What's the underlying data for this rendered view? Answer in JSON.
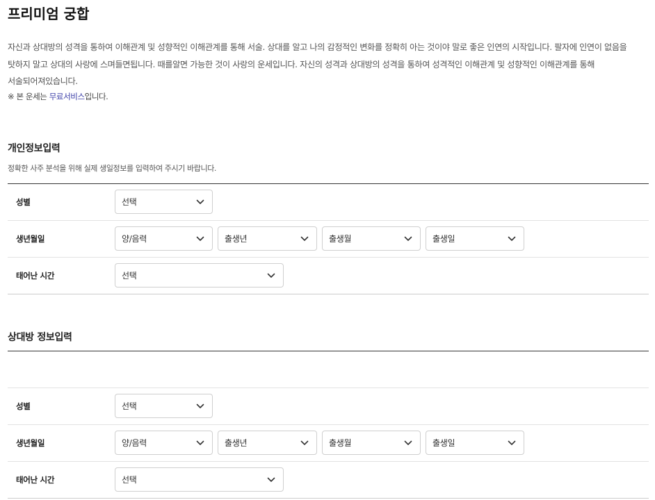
{
  "page": {
    "title": "프리미엄 궁합",
    "description": "자신과 상대방의 성격을 통하여 이해관계 및 성향적인 이해관계를 통해 서술. 상대를 알고 나의 감정적인 변화를 정확히 아는 것이야 말로 좋은 인연의 시작입니다. 팔자에 인연이 없음을 탓하지 말고 상대의 사랑에 스며들면됩니다. 때를알면 가능한 것이 사랑의 운세입니다. 자신의 성격과 상대방의 성격을 통하여 성격적인 이해관계 및 성향적인 이해관계를 통해 서술되어져있습니다.",
    "notice_prefix": "※ 본 운세는 ",
    "notice_link": "무료서비스",
    "notice_suffix": "입니다."
  },
  "my_info": {
    "title": "개인정보입력",
    "desc": "정확한 사주 분석을 위해 실제 생일정보를 입력하여 주시기 바랍니다.",
    "gender": {
      "label": "성별",
      "value": "선택"
    },
    "birth": {
      "label": "생년월일",
      "calendar": "양/음력",
      "year": "출생년",
      "month": "출생월",
      "day": "출생일"
    },
    "time": {
      "label": "태어난 시간",
      "value": "선택"
    }
  },
  "partner_info": {
    "title": "상대방 정보입력",
    "gender": {
      "label": "성별",
      "value": "선택"
    },
    "birth": {
      "label": "생년월일",
      "calendar": "양/음력",
      "year": "출생년",
      "month": "출생월",
      "day": "출생일"
    },
    "time": {
      "label": "태어난 시간",
      "value": "선택"
    }
  },
  "icons": {
    "select_arrow": "chevron-down-icon"
  },
  "colors": {
    "link": "#3c3fa8",
    "table_top_border": "#333333",
    "row_border": "#e2e2e2",
    "select_border": "#cfcfcf"
  }
}
